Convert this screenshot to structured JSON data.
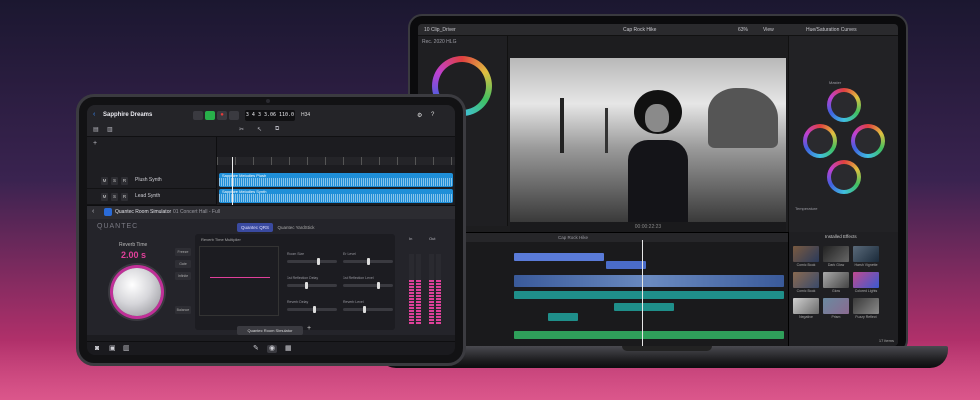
{
  "logic_pro": {
    "project_title": "Sapphire Dreams",
    "lcd_readout": "3 4 3 3.06  110.0",
    "key_readout": "H34",
    "tracks": [
      {
        "name": "Plush Synth",
        "region": "Sapphire Melodies Plush"
      },
      {
        "name": "Lead Synth",
        "region": "Sapphire Melodies Synth"
      }
    ],
    "plugin": {
      "name": "Quantec Room Simulator",
      "preset": "01 Concert Hall - Full",
      "brand": "QUANTEC",
      "mode_tabs": [
        "Quantec QRS",
        "Quantec YardStick"
      ],
      "reverb_time_label": "Reverb Time",
      "reverb_time_value": "2.00 s",
      "side_buttons": [
        "Freeze",
        "Gate",
        "Infinite",
        "Balance"
      ],
      "graph_label": "Reverb Time Multiplier",
      "sliders": [
        "Room Size",
        "Er Level",
        "1st Reflection Delay",
        "1st Reflection Level",
        "Reverb Delay",
        "Reverb Level"
      ],
      "meter_labels": [
        "In",
        "Out"
      ],
      "pill_label": "Quantec Room Simulator"
    }
  },
  "fcp": {
    "top_left": "10 Clip_Driver",
    "top_center": "Cap Rock Hike",
    "zoom": "63%",
    "view": "View",
    "inspector_title": "Hue/Saturation Curves",
    "library": "Rec. 2020 HLG",
    "timecode": "00:00:22:23",
    "wheel_labels": [
      "Master",
      "Shadows",
      "Midtones",
      "Highlights"
    ],
    "temperature_label": "Temperature",
    "timeline_title": "Cap Rock Hike",
    "effects_title": "Installed Effects",
    "effects": [
      "Comic Book",
      "Dark Glow",
      "Harsh Vignette",
      "Comic Book",
      "Glow",
      "Colored Lights",
      "Negative",
      "Prism",
      "Fuzzy Reflect"
    ],
    "items_count": "17 items"
  },
  "colors": {
    "accent_magenta": "#e0409a",
    "logic_blue": "#2a6bd8",
    "clip_blue": "#1f8fd8",
    "clip_teal": "#1f8f8a",
    "clip_green": "#2f9f5a"
  }
}
